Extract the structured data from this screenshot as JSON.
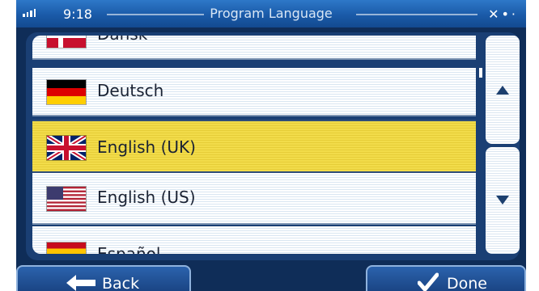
{
  "status_bar": {
    "time": "9:18",
    "title": "Program Language"
  },
  "language_list": {
    "items": [
      {
        "label": "Dansk",
        "flag": "denmark-flag-icon",
        "selected": false
      },
      {
        "label": "Deutsch",
        "flag": "germany-flag-icon",
        "selected": false
      },
      {
        "label": "English (UK)",
        "flag": "uk-flag-icon",
        "selected": true
      },
      {
        "label": "English (US)",
        "flag": "us-flag-icon",
        "selected": false
      },
      {
        "label": "Español",
        "flag": "spain-flag-icon",
        "selected": false
      }
    ]
  },
  "buttons": {
    "back_label": "Back",
    "done_label": "Done"
  },
  "colors": {
    "selected_row": "#f2dc4a",
    "button_blue": "#1f4f95",
    "status_bar_blue": "#1a5aa8"
  }
}
